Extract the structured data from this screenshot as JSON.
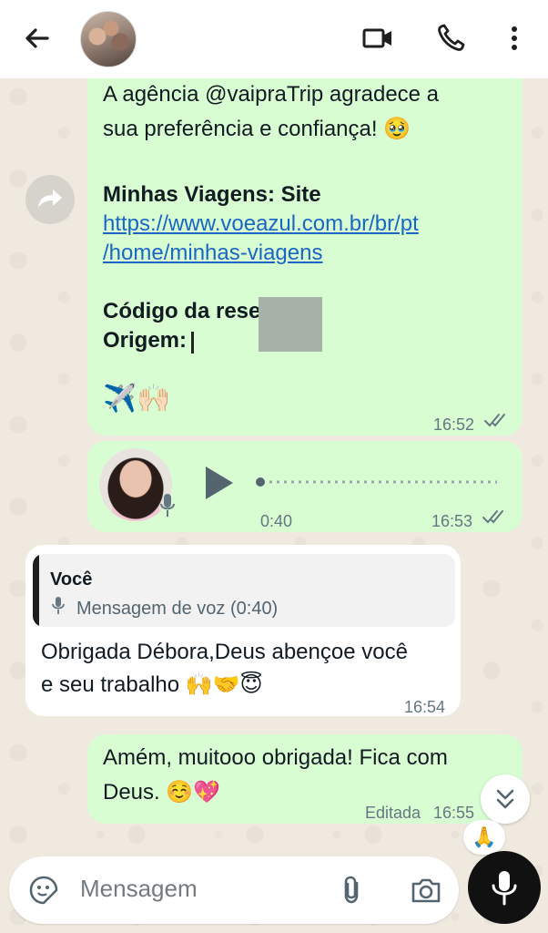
{
  "header": {
    "back_icon": "arrow-left-icon",
    "video_icon": "video-camera-icon",
    "phone_icon": "phone-icon",
    "more_icon": "more-vertical-icon"
  },
  "messages": {
    "forwarded_receipt": {
      "line1": "A agência @vaipraTrip agradece a",
      "line2": "sua preferência e confiança! 🥹",
      "site_label": "Minhas Viagens: Site",
      "link_line1": "https://www.voeazul.com.br/br/pt",
      "link_line2": "/home/minhas-viagens",
      "code_label": "Código da reserva:",
      "origin_label": "Origem:",
      "emojis": "✈️🙌🏻",
      "time": "16:52"
    },
    "voice_note": {
      "duration": "0:40",
      "time": "16:53"
    },
    "reply": {
      "quote_author": "Você",
      "quote_text": "Mensagem de voz (0:40)",
      "line1": "Obrigada Débora,Deus abençoe você",
      "line2": "e seu trabalho 🙌🤝😇",
      "time": "16:54"
    },
    "last": {
      "line1": "Amém, muitooo obrigada! Fica com",
      "line2": "Deus. ☺️💖",
      "edited_label": "Editada",
      "time": "16:55",
      "reaction": "🙏"
    }
  },
  "composer": {
    "placeholder": "Mensagem"
  },
  "colors": {
    "outgoing_bubble": "#d9fdd3",
    "incoming_bubble": "#ffffff",
    "link": "#1a66c4"
  }
}
